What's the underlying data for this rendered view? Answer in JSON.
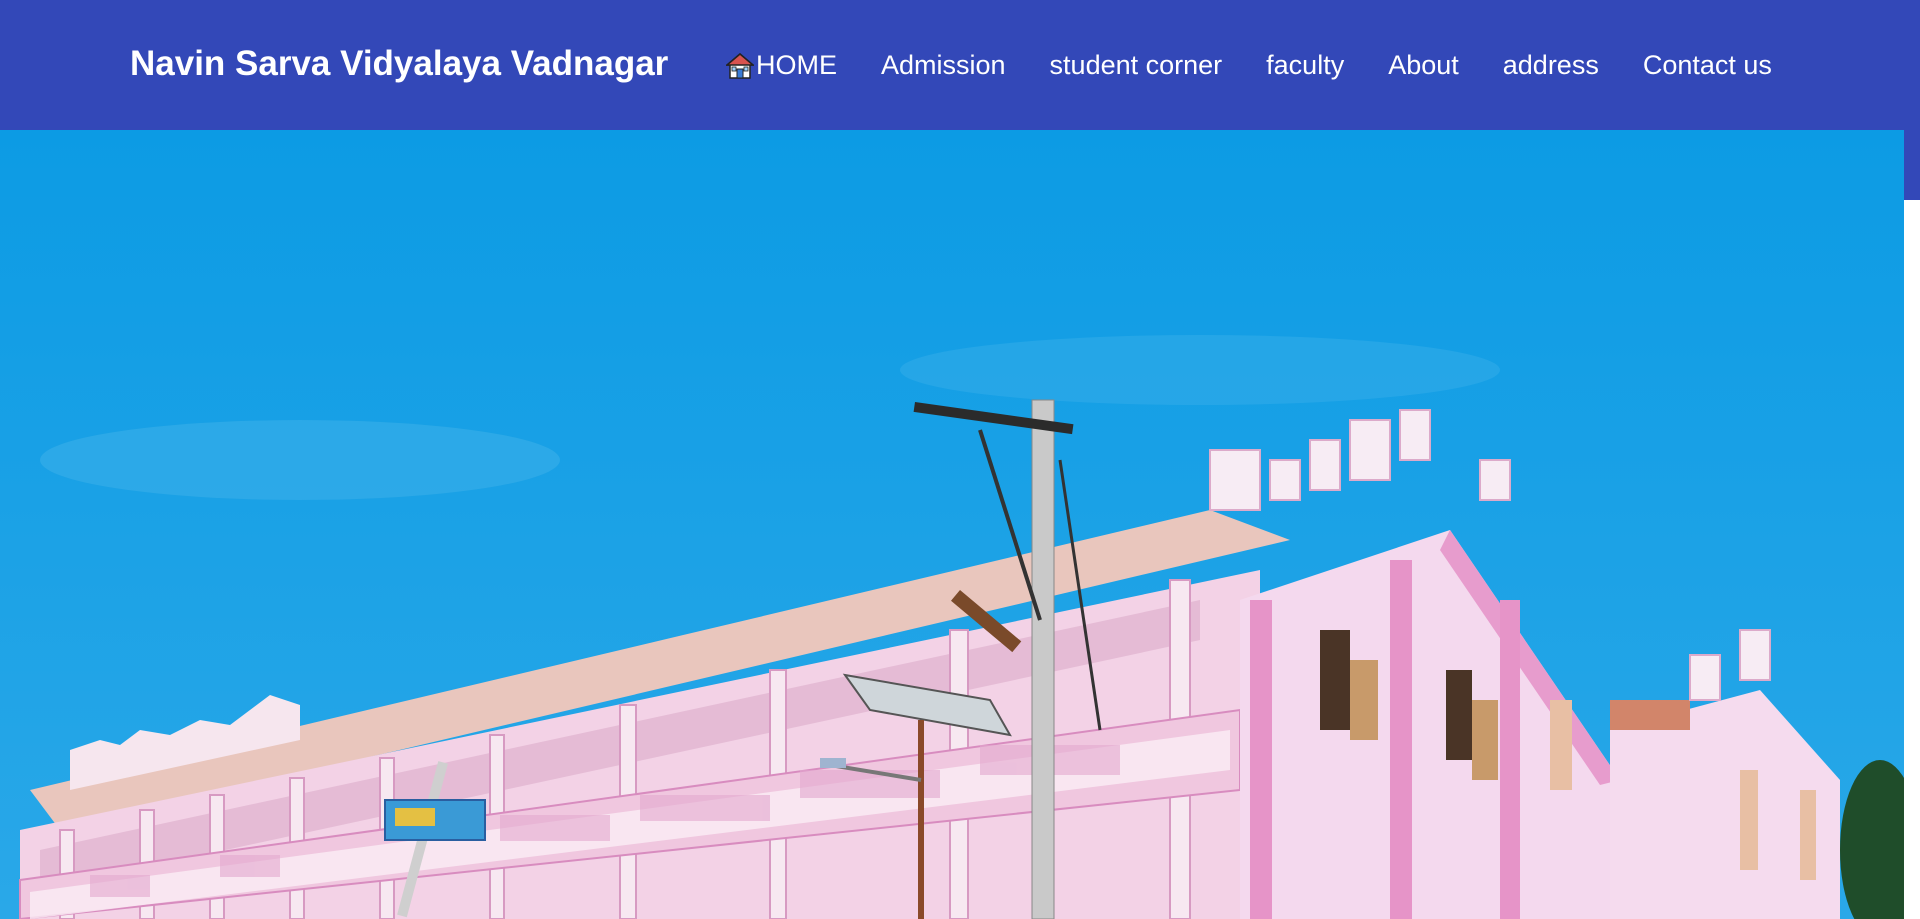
{
  "header": {
    "brand": "Navin Sarva Vidyalaya Vadnagar"
  },
  "nav": {
    "items": [
      {
        "label": "HOME",
        "icon": "house-icon"
      },
      {
        "label": "Admission"
      },
      {
        "label": "student corner"
      },
      {
        "label": "faculty"
      },
      {
        "label": "About"
      },
      {
        "label": "address"
      },
      {
        "label": "Contact us"
      }
    ]
  },
  "colors": {
    "navbar": "#3348b8",
    "sky": "#1da1e6",
    "building": "#f4d6ec",
    "building_trim": "#e08cc8"
  }
}
